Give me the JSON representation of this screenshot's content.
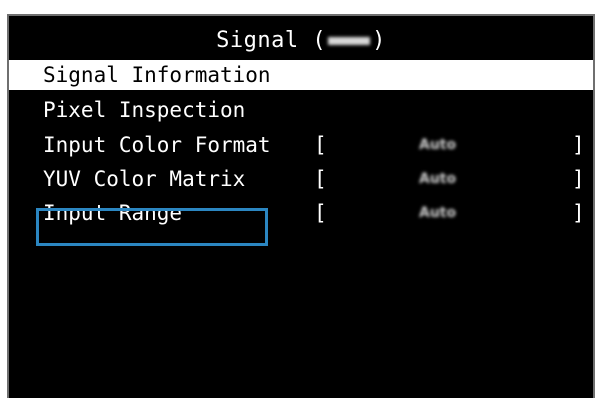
{
  "menu": {
    "title": "Signal",
    "title_obscured_suffix": "(••••)",
    "items": [
      {
        "label": "Signal Information",
        "selected": true
      },
      {
        "label": "Pixel Inspection"
      },
      {
        "label": "Input Color Format",
        "bracket_open": "[",
        "value": "Auto",
        "bracket_close": "]"
      },
      {
        "label": "YUV Color Matrix",
        "bracket_open": "[",
        "value": "Auto",
        "bracket_close": "]"
      },
      {
        "label": "Input Range",
        "bracket_open": "[",
        "value": "Auto",
        "bracket_close": "]",
        "focused": true
      }
    ]
  },
  "colors": {
    "background": "#000000",
    "selected_bg": "#ffffff",
    "focus_border": "#2b86c1",
    "text": "#ffffff"
  }
}
